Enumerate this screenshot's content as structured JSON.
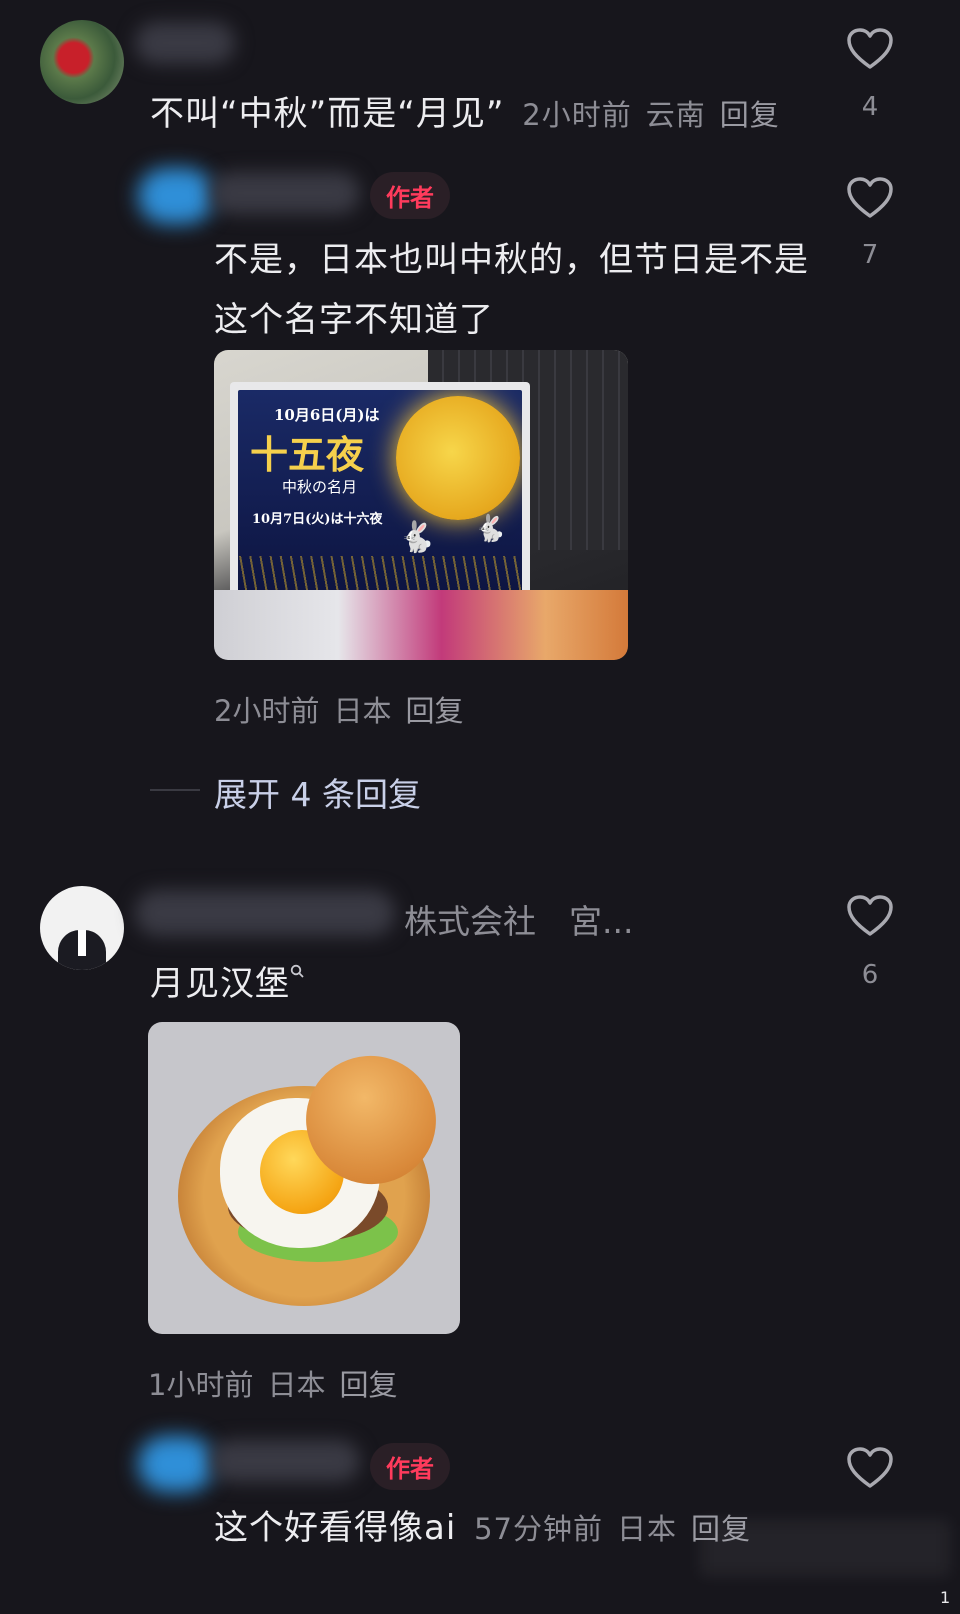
{
  "comments": [
    {
      "text": "不叫“中秋”而是“月见”",
      "time": "2小时前",
      "location": "云南",
      "reply": "回复",
      "likes": "4"
    },
    {
      "author_tag": "作者",
      "text": "不是，日本也叫中秋的，但节日是不是这个名字不知道了",
      "time": "2小时前",
      "location": "日本",
      "reply": "回复",
      "likes": "7",
      "poster": {
        "date_line": "10月6日(月)は",
        "title": "十五夜",
        "subtitle": "中秋の名月",
        "date_line2": "10月7日(火)は十六夜"
      }
    },
    {
      "username_suffix": "株式会社　宮...",
      "text": "月见汉堡",
      "time": "1小时前",
      "location": "日本",
      "reply": "回复",
      "likes": "6"
    },
    {
      "author_tag": "作者",
      "text": "这个好看得像ai",
      "time": "57分钟前",
      "location": "日本",
      "reply": "回复"
    }
  ],
  "expand_replies": "展开 4 条回复",
  "corner_digit": "1",
  "colors": {
    "background": "#17161c",
    "author_tag": "#ff3b5c",
    "meta_text": "#8d8d95"
  },
  "icons": {
    "like": "heart-outline-icon",
    "search_hint": "search-icon"
  }
}
